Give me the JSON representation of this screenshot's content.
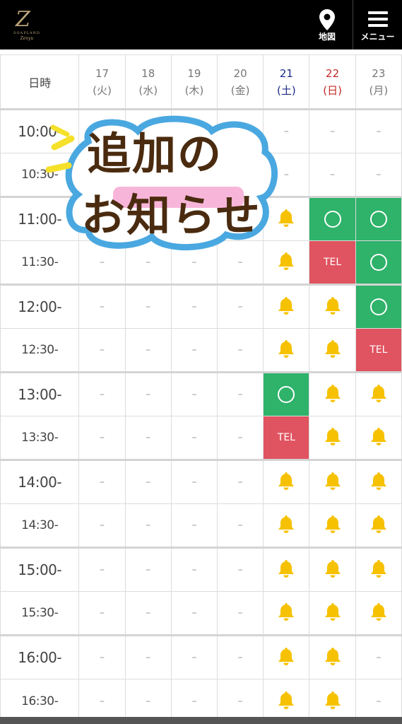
{
  "header": {
    "logo_letter": "Z",
    "logo_line1": "SOAPLAND",
    "logo_line2": "Zenyu",
    "map_label": "地図",
    "menu_label": "メニュー"
  },
  "schedule": {
    "corner_label": "日時",
    "days": [
      {
        "date": "17",
        "weekday": "(火)",
        "type": "weekday"
      },
      {
        "date": "18",
        "weekday": "(水)",
        "type": "weekday"
      },
      {
        "date": "19",
        "weekday": "(木)",
        "type": "weekday"
      },
      {
        "date": "20",
        "weekday": "(金)",
        "type": "weekday"
      },
      {
        "date": "21",
        "weekday": "(土)",
        "type": "sat"
      },
      {
        "date": "22",
        "weekday": "(日)",
        "type": "sun"
      },
      {
        "date": "23",
        "weekday": "(月)",
        "type": "weekday"
      }
    ],
    "rows": [
      {
        "time": "10:00-",
        "cells": [
          "-",
          "-",
          "-",
          "-",
          "-",
          "-",
          "-"
        ]
      },
      {
        "time": "10:30-",
        "cells": [
          "-",
          "-",
          "-",
          "-",
          "-",
          "-",
          "-"
        ]
      },
      {
        "time": "11:00-",
        "cells": [
          "-",
          "-",
          "-",
          "-",
          "bell",
          "ok",
          "ok"
        ]
      },
      {
        "time": "11:30-",
        "cells": [
          "-",
          "-",
          "-",
          "-",
          "bell",
          "tel",
          "ok"
        ]
      },
      {
        "time": "12:00-",
        "cells": [
          "-",
          "-",
          "-",
          "-",
          "bell",
          "bell",
          "ok"
        ]
      },
      {
        "time": "12:30-",
        "cells": [
          "-",
          "-",
          "-",
          "-",
          "bell",
          "bell",
          "tel"
        ]
      },
      {
        "time": "13:00-",
        "cells": [
          "-",
          "-",
          "-",
          "-",
          "ok",
          "bell",
          "bell"
        ]
      },
      {
        "time": "13:30-",
        "cells": [
          "-",
          "-",
          "-",
          "-",
          "tel",
          "bell",
          "bell"
        ]
      },
      {
        "time": "14:00-",
        "cells": [
          "-",
          "-",
          "-",
          "-",
          "bell",
          "bell",
          "bell"
        ]
      },
      {
        "time": "14:30-",
        "cells": [
          "-",
          "-",
          "-",
          "-",
          "bell",
          "bell",
          "bell"
        ]
      },
      {
        "time": "15:00-",
        "cells": [
          "-",
          "-",
          "-",
          "-",
          "bell",
          "bell",
          "bell"
        ]
      },
      {
        "time": "15:30-",
        "cells": [
          "-",
          "-",
          "-",
          "-",
          "bell",
          "bell",
          "bell"
        ]
      },
      {
        "time": "16:00-",
        "cells": [
          "-",
          "-",
          "-",
          "-",
          "bell",
          "bell",
          "-"
        ]
      },
      {
        "time": "16:30-",
        "cells": [
          "-",
          "-",
          "-",
          "-",
          "bell",
          "bell",
          "-"
        ]
      }
    ],
    "dash_text": "–",
    "tel_text": "TEL"
  },
  "sticker": {
    "line1": "追加の",
    "line2": "お知らせ"
  },
  "colors": {
    "available": "#2fb26a",
    "tel": "#e05360",
    "bell": "#f6c100",
    "saturday": "#1c2a8a",
    "sunday": "#c62828"
  },
  "icons": {
    "map": "map-pin-icon",
    "menu": "hamburger-menu-icon",
    "bell": "bell-icon",
    "available": "circle-icon"
  }
}
